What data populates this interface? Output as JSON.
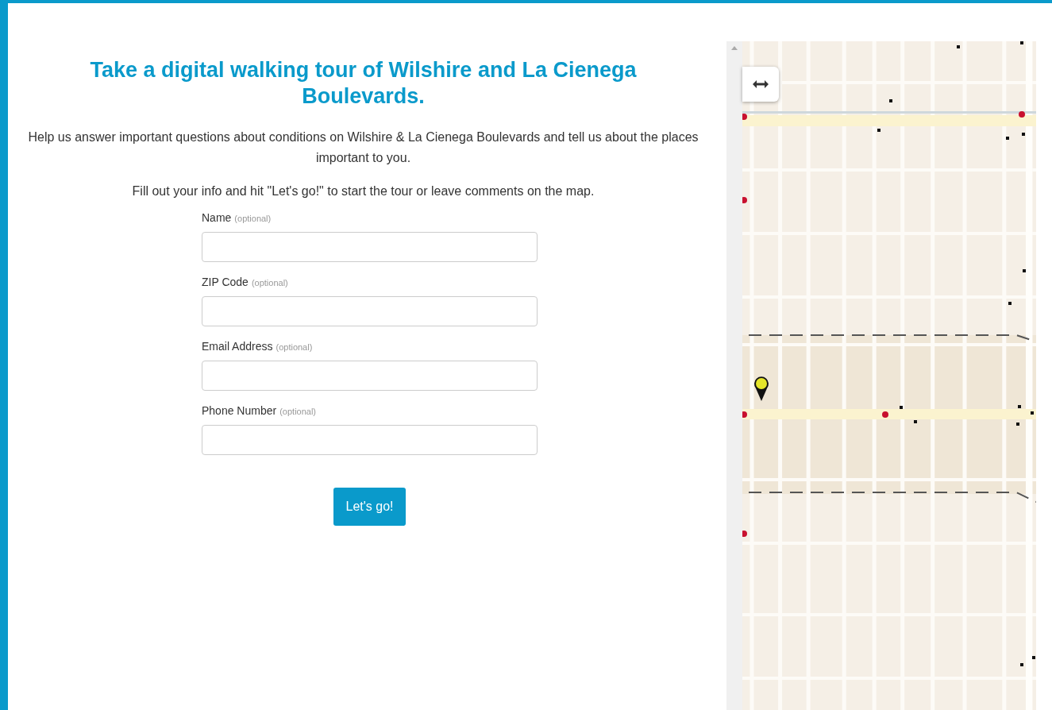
{
  "intro": {
    "title": "Take a digital walking tour of Wilshire and La Cienega Boulevards.",
    "paragraphs": [
      "Help us answer important questions about conditions on Wilshire & La Cienega Boulevards and tell us about the places important to you.",
      "Fill out your info and hit \"Let's go!\" to start the tour or leave comments on the map."
    ]
  },
  "form": {
    "fields": [
      {
        "label": "Name",
        "hint": "(optional)"
      },
      {
        "label": "ZIP Code",
        "hint": "(optional)"
      },
      {
        "label": "Email Address",
        "hint": "(optional)"
      },
      {
        "label": "Phone Number",
        "hint": "(optional)"
      }
    ],
    "submit": "Let's go!"
  }
}
